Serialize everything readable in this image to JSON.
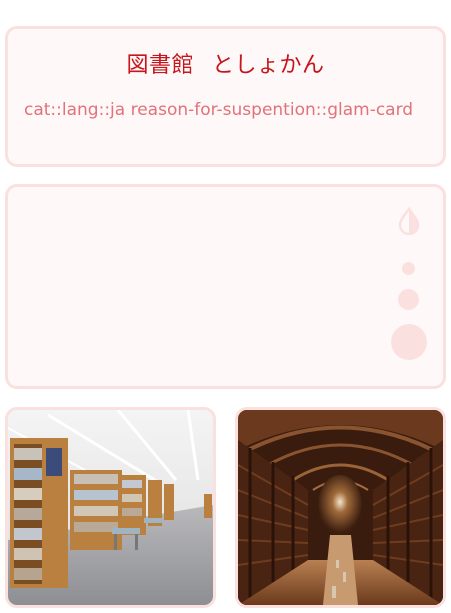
{
  "card": {
    "word": "図書館",
    "reading": "としょかん",
    "tags": "cat::lang::ja reason-for-suspention::glam-card"
  },
  "colors": {
    "title": "#c4161c",
    "tags": "#e0727a",
    "border": "#fbe0e0",
    "card_bg": "#fff8f8"
  },
  "controls": {
    "icons": [
      "contrast-icon",
      "dot-small-icon",
      "dot-medium-icon",
      "dot-large-icon"
    ]
  },
  "images": [
    {
      "name": "modern-library-photo"
    },
    {
      "name": "classic-library-photo"
    }
  ]
}
